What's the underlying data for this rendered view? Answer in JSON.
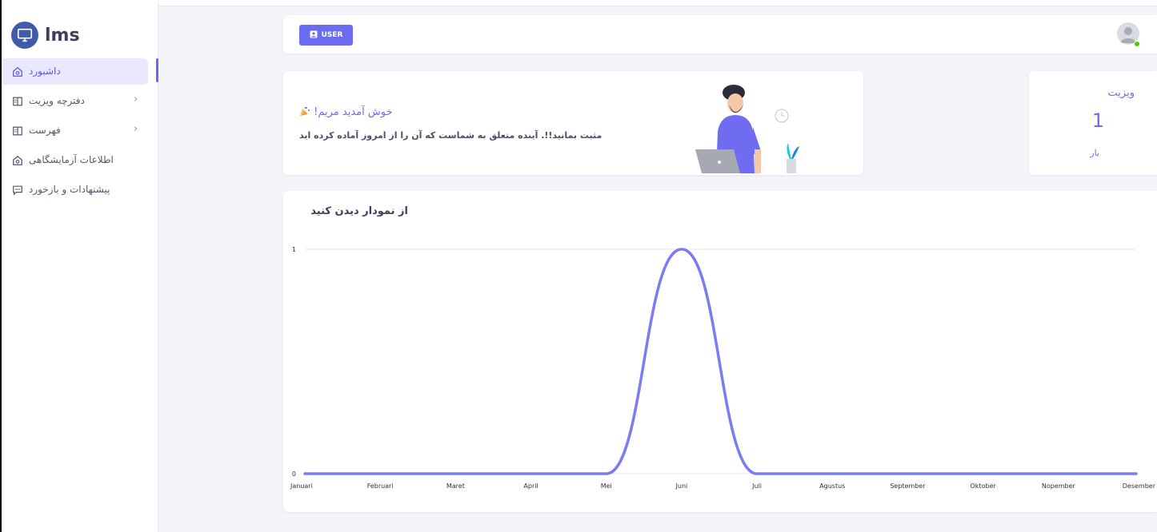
{
  "brand": {
    "name": "lms",
    "logo_icon": "computer-icon",
    "accent": "#3f5ba9"
  },
  "sidebar": {
    "items": [
      {
        "label": "داشبورد",
        "icon": "home-icon",
        "active": true
      },
      {
        "label": "دفترچه ویزیت",
        "icon": "book-icon",
        "has_submenu": true
      },
      {
        "label": "فهرست",
        "icon": "book-icon",
        "has_submenu": true
      },
      {
        "label": "اطلاعات آزمایشگاهی",
        "icon": "home-icon"
      },
      {
        "label": "پیشنهادات و بازخورد",
        "icon": "message-icon"
      }
    ]
  },
  "topbar": {
    "user_button_label": "USER",
    "user_status": "online"
  },
  "welcome": {
    "title": "!خوش آمدید مریم",
    "emoji": "party-popper",
    "subtitle": "مثبت بمانید!!. آینده متعلق به شماست که آن را از امروز آماده کرده اید"
  },
  "visit": {
    "title": "ویزیت",
    "count": "1",
    "unit": "بار"
  },
  "chart": {
    "title": "از نمودار دیدن کنید"
  },
  "chart_data": {
    "type": "line",
    "title": "از نمودار دیدن کنید",
    "categories": [
      "Januari",
      "Februari",
      "Maret",
      "April",
      "Mei",
      "Juni",
      "Juli",
      "Agustus",
      "September",
      "Oktober",
      "Nopember",
      "Desember"
    ],
    "series": [
      {
        "values": [
          0,
          0,
          0,
          0,
          0,
          1,
          0,
          0,
          0,
          0,
          0,
          0
        ],
        "color": "#7b7bf2"
      }
    ],
    "ylim": [
      0,
      1
    ],
    "yticks": [
      "0",
      "1"
    ],
    "grid": true,
    "smooth": true
  },
  "colors": {
    "primary": "#6c6cf0",
    "background": "#f4f5fa",
    "online": "#56ca00"
  }
}
